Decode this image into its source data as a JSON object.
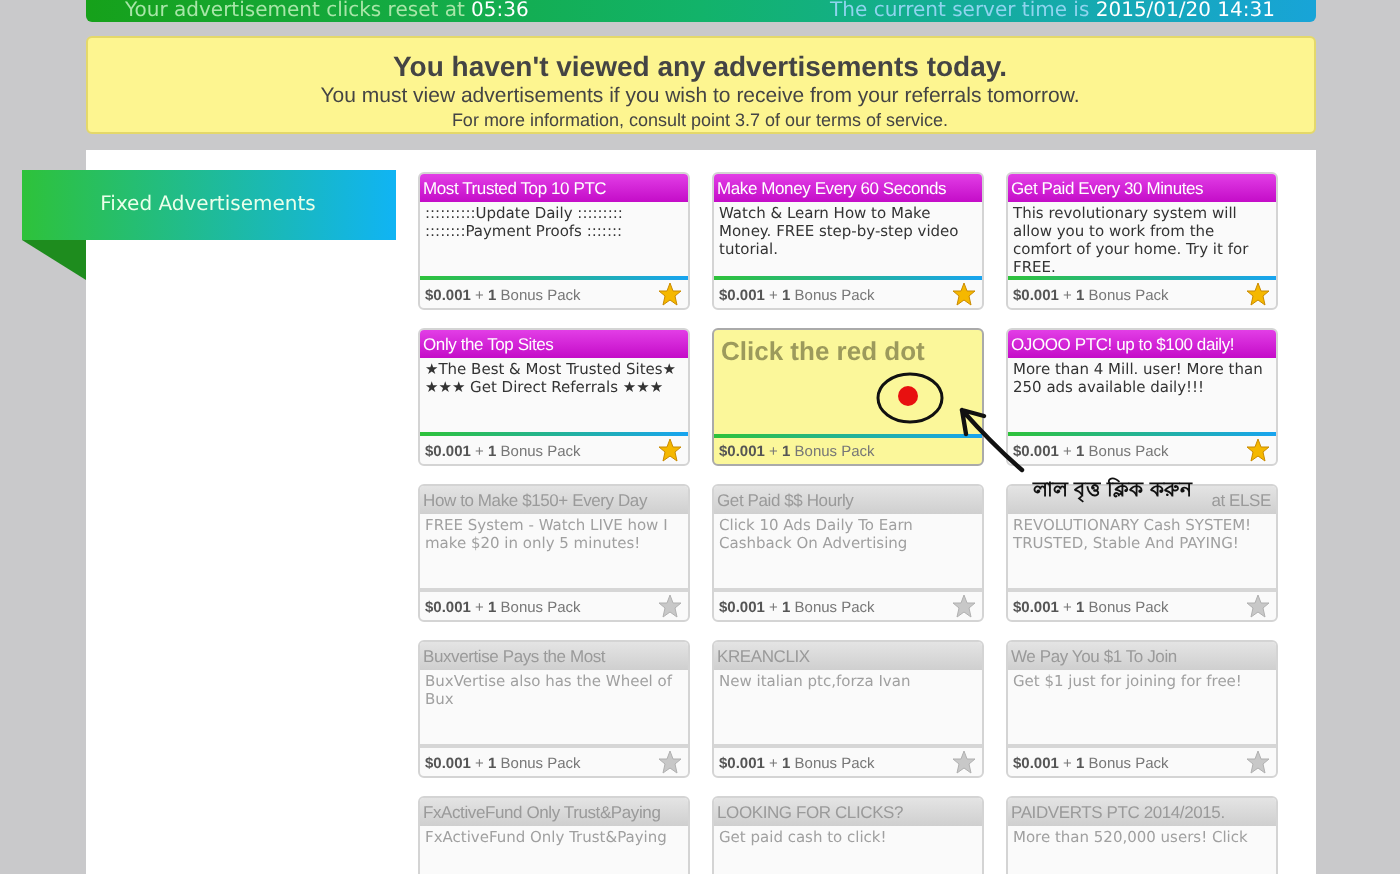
{
  "top_bar": {
    "reset_text": "Your advertisement clicks reset at **05:36**",
    "server_text": "The current server time is **2015/01/20 14:31**"
  },
  "notice": {
    "title": "You haven't viewed any advertisements today.",
    "line_1": "You must view advertisements if you wish to receive from your referrals tomorrow.",
    "line_2": "For more information, consult point 3.7 of our terms of service."
  },
  "sidebar": {
    "ribbon": "Fixed Advertisements"
  },
  "ads": [
    {
      "kind": "active",
      "title": "Most Trusted Top 10 PTC",
      "body": "::::::::::Update Daily ::::::::: ::::::::Payment Proofs :::::::",
      "footer": "**$0.001** + **1** Bonus Pack"
    },
    {
      "kind": "active",
      "title": "Make Money Every 60 Seconds",
      "body": "Watch & Learn How to Make Money. FREE step-by-step video tutorial.",
      "footer": "**$0.001** + **1** Bonus Pack"
    },
    {
      "kind": "active",
      "title": "Get Paid Every 30 Minutes",
      "body": "This revolutionary system will allow you to work from the comfort of your home. Try it for FREE.",
      "footer": "**$0.001** + **1** Bonus Pack"
    },
    {
      "kind": "active",
      "title": "Only the Top Sites",
      "body": "★The Best & Most Trusted Sites★ ★★★ Get Direct Referrals ★★★",
      "footer": "**$0.001** + **1** Bonus Pack"
    },
    {
      "kind": "special",
      "title": "Click the red dot",
      "footer": "**$0.001** + **1** Bonus Pack"
    },
    {
      "kind": "active",
      "title": "OJOOO PTC! up to $100 daily!",
      "body": "More than 4 Mill. user! More than 250 ads available daily!!!",
      "footer": "**$0.001** + **1** Bonus Pack"
    },
    {
      "kind": "viewed",
      "title": "How to Make $150+ Every Day",
      "body": "FREE System - Watch LIVE how I make $20 in only 5 minutes!",
      "footer": "**$0.001** + **1** Bonus Pack"
    },
    {
      "kind": "viewed",
      "title": "Get Paid $$ Hourly",
      "body": "Click 10 Ads Daily To Earn Cashback On Advertising",
      "footer": "**$0.001** + **1** Bonus Pack"
    },
    {
      "kind": "viewed",
      "title": "at ELSE",
      "body": "REVOLUTIONARY Cash SYSTEM! TRUSTED, Stable And PAYING!",
      "footer": "**$0.001** + **1** Bonus Pack"
    },
    {
      "kind": "viewed",
      "title": "Buxvertise Pays the Most",
      "body": "BuxVertise also has the Wheel of Bux",
      "footer": "**$0.001** + **1** Bonus Pack"
    },
    {
      "kind": "viewed",
      "title": "KREANCLIX",
      "body": "New italian ptc,forza Ivan",
      "footer": "**$0.001** + **1** Bonus Pack"
    },
    {
      "kind": "viewed",
      "title": "We Pay You $1 To Join",
      "body": "Get $1 just for joining for free!",
      "footer": "**$0.001** + **1** Bonus Pack"
    },
    {
      "kind": "viewed",
      "title": "FxActiveFund Only Trust&Paying",
      "body": "FxActiveFund Only Trust&Paying"
    },
    {
      "kind": "viewed",
      "title": "LOOKING FOR CLICKS?",
      "body": "Get paid cash to click!"
    },
    {
      "kind": "viewed",
      "title": "PAIDVERTS PTC 2014/2015.",
      "body": "More than 520,000 users! Click"
    }
  ],
  "annotation": {
    "text": "লাল বৃত্ত ক্লিক করুন"
  }
}
